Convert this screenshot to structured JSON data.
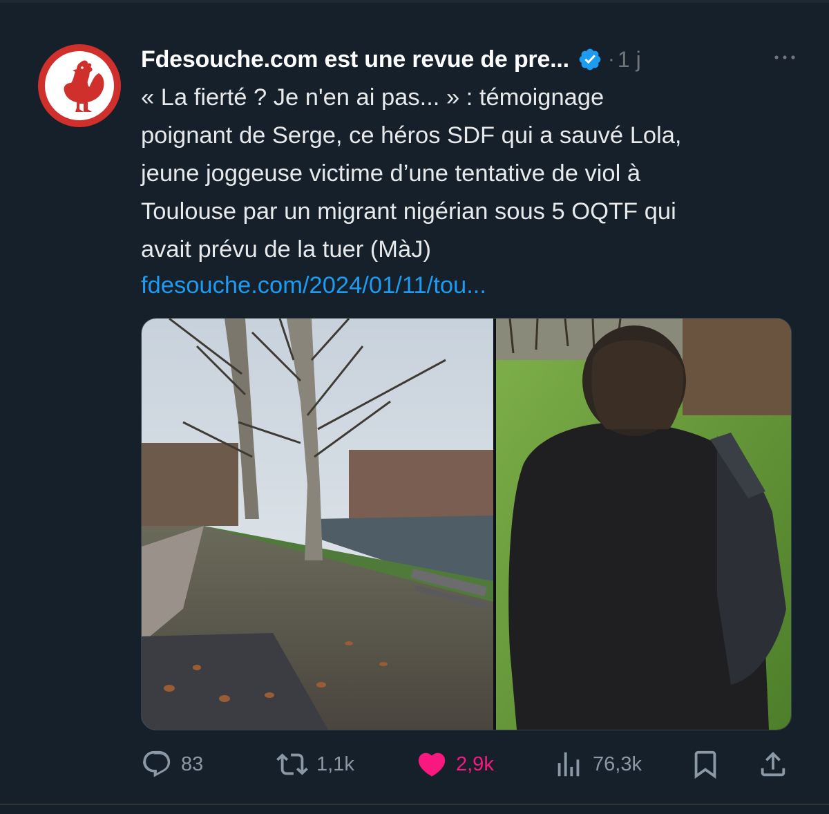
{
  "author": {
    "name": "Fdesouche.com est une revue de pre...",
    "verified": true,
    "time": "1 j"
  },
  "tweet": {
    "text": "« La fierté ? Je n'en ai pas... » : témoignage\npoignant de Serge, ce héros SDF qui a sauvé Lola,\njeune joggeuse victime d’une tentative de viol à\nToulouse par un migrant nigérian sous 5 OQTF qui\navait prévu de la tuer (MàJ)",
    "link": "fdesouche.com/2024/01/11/tou..."
  },
  "actions": {
    "replies": "83",
    "retweets": "1,1k",
    "likes": "2,9k",
    "views": "76,3k"
  },
  "colors": {
    "background": "#15202b",
    "link": "#1d9bf0",
    "like": "#f91880",
    "verified": "#1d9bf0",
    "avatar": "#d0302c"
  },
  "icons": [
    "rooster-logo-icon",
    "verified-badge-icon",
    "more-icon",
    "reply-icon",
    "retweet-icon",
    "like-icon",
    "views-icon",
    "bookmark-icon",
    "share-icon"
  ]
}
